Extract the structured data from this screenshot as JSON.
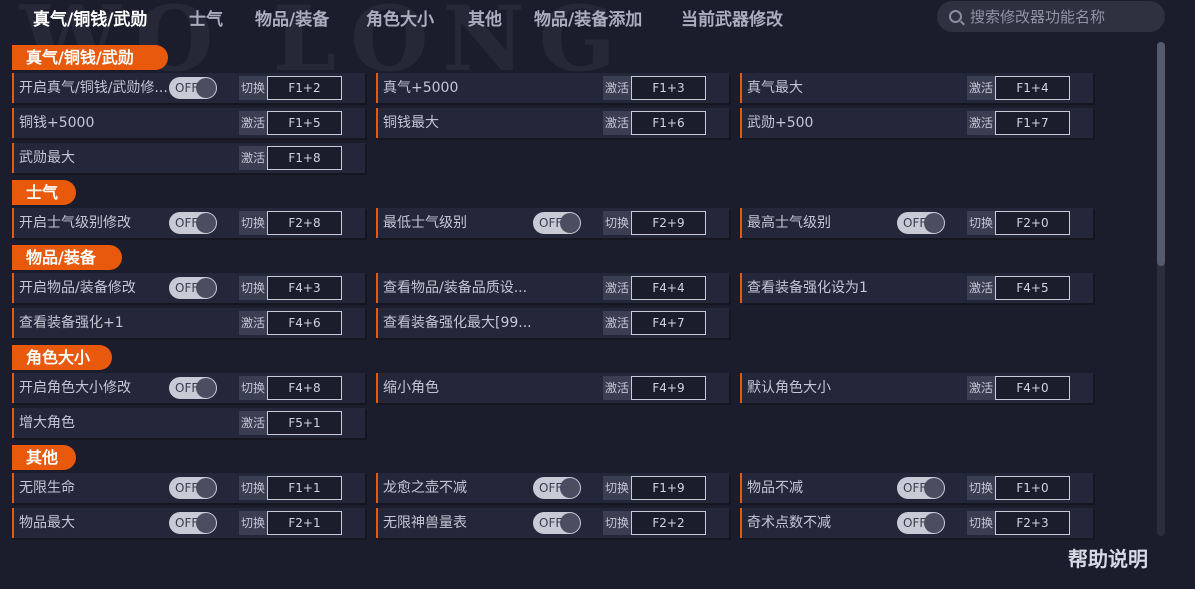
{
  "watermark": "WO LONG",
  "nav": {
    "tabs": [
      "真气/铜钱/武勋",
      "士气",
      "物品/装备",
      "角色大小",
      "其他",
      "物品/装备添加",
      "当前武器修改"
    ],
    "active_index": 0
  },
  "search": {
    "placeholder": "搜索修改器功能名称"
  },
  "sections": [
    {
      "title": "真气/铜钱/武勋",
      "rows": [
        {
          "label": "开启真气/铜钱/武勋修...",
          "toggle": "OFF",
          "action": "切换",
          "hotkey": "F1+2"
        },
        {
          "label": "真气+5000",
          "action": "激活",
          "hotkey": "F1+3"
        },
        {
          "label": "真气最大",
          "action": "激活",
          "hotkey": "F1+4"
        },
        {
          "label": "铜钱+5000",
          "action": "激活",
          "hotkey": "F1+5"
        },
        {
          "label": "铜钱最大",
          "action": "激活",
          "hotkey": "F1+6"
        },
        {
          "label": "武勋+500",
          "action": "激活",
          "hotkey": "F1+7"
        },
        {
          "label": "武勋最大",
          "action": "激活",
          "hotkey": "F1+8"
        }
      ]
    },
    {
      "title": "士气",
      "rows": [
        {
          "label": "开启士气级别修改",
          "toggle": "OFF",
          "action": "切换",
          "hotkey": "F2+8"
        },
        {
          "label": "最低士气级别",
          "toggle": "OFF",
          "action": "切换",
          "hotkey": "F2+9"
        },
        {
          "label": "最高士气级别",
          "toggle": "OFF",
          "action": "切换",
          "hotkey": "F2+0"
        }
      ]
    },
    {
      "title": "物品/装备",
      "rows": [
        {
          "label": "开启物品/装备修改",
          "toggle": "OFF",
          "action": "切换",
          "hotkey": "F4+3"
        },
        {
          "label": "查看物品/装备品质设...",
          "action": "激活",
          "hotkey": "F4+4"
        },
        {
          "label": "查看装备强化设为1",
          "action": "激活",
          "hotkey": "F4+5"
        },
        {
          "label": "查看装备强化+1",
          "action": "激活",
          "hotkey": "F4+6"
        },
        {
          "label": "查看装备强化最大[99...",
          "action": "激活",
          "hotkey": "F4+7"
        }
      ]
    },
    {
      "title": "角色大小",
      "rows": [
        {
          "label": "开启角色大小修改",
          "toggle": "OFF",
          "action": "切换",
          "hotkey": "F4+8"
        },
        {
          "label": "缩小角色",
          "action": "激活",
          "hotkey": "F4+9"
        },
        {
          "label": "默认角色大小",
          "action": "激活",
          "hotkey": "F4+0"
        },
        {
          "label": "增大角色",
          "action": "激活",
          "hotkey": "F5+1"
        }
      ]
    },
    {
      "title": "其他",
      "rows": [
        {
          "label": "无限生命",
          "toggle": "OFF",
          "action": "切换",
          "hotkey": "F1+1"
        },
        {
          "label": "龙愈之壶不减",
          "toggle": "OFF",
          "action": "切换",
          "hotkey": "F1+9"
        },
        {
          "label": "物品不减",
          "toggle": "OFF",
          "action": "切换",
          "hotkey": "F1+0"
        },
        {
          "label": "物品最大",
          "toggle": "OFF",
          "action": "切换",
          "hotkey": "F2+1"
        },
        {
          "label": "无限神兽量表",
          "toggle": "OFF",
          "action": "切换",
          "hotkey": "F2+2"
        },
        {
          "label": "奇术点数不减",
          "toggle": "OFF",
          "action": "切换",
          "hotkey": "F2+3"
        }
      ]
    }
  ],
  "help_label": "帮助说明",
  "colors": {
    "accent": "#e8590c",
    "background": "#1b1d2c",
    "row": "#24273a"
  }
}
